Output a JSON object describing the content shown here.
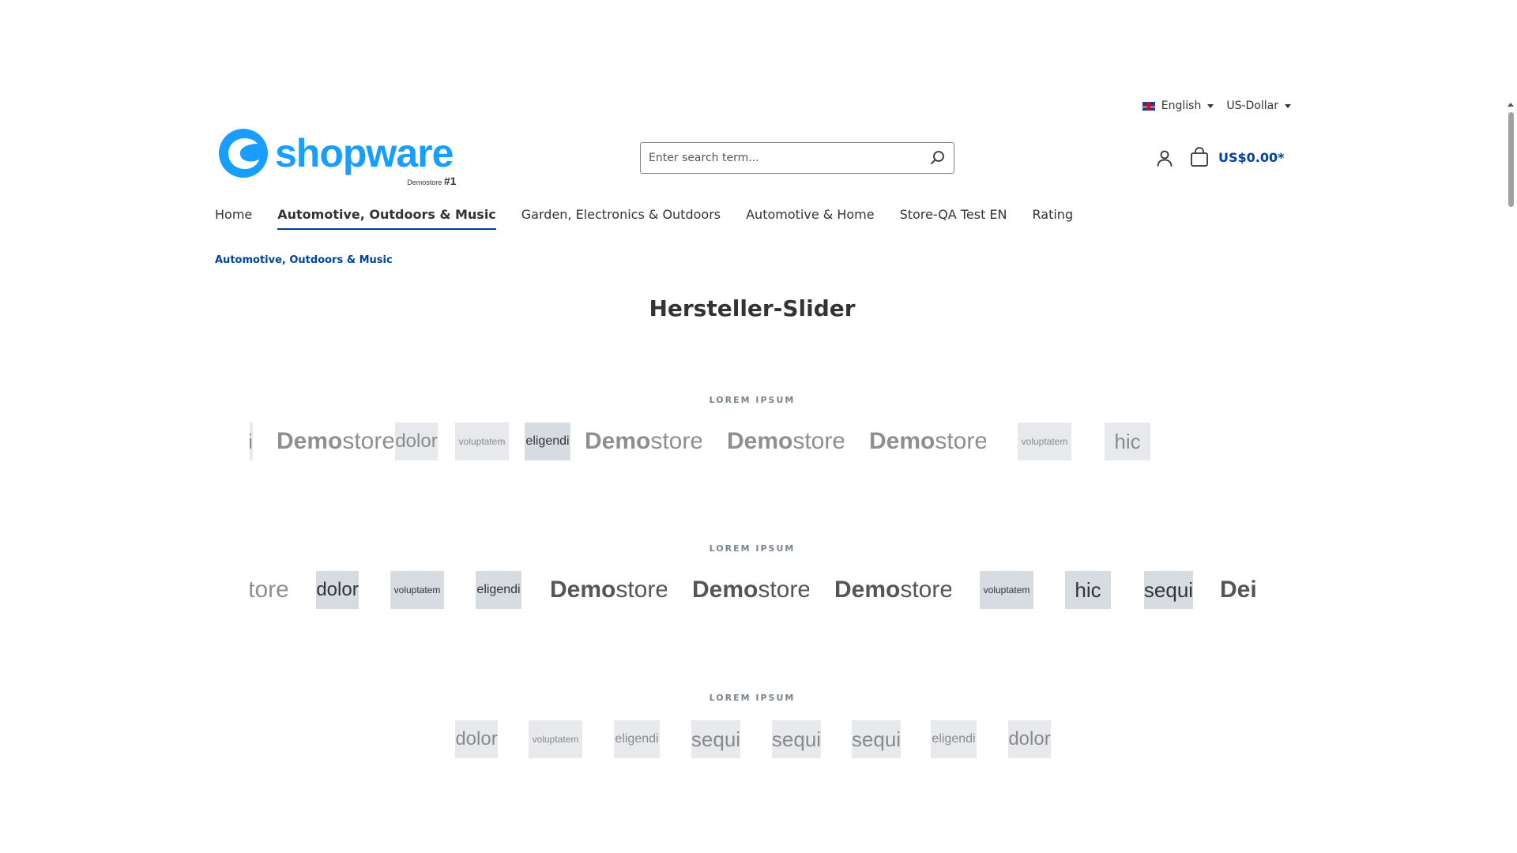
{
  "topbar": {
    "language": "English",
    "currency": "US-Dollar"
  },
  "header": {
    "logo_text": "shopware",
    "logo_sub": "Demostore",
    "logo_badge": "#1",
    "search_placeholder": "Enter search term...",
    "cart_total": "US$0.00*"
  },
  "nav": {
    "items": [
      {
        "label": "Home"
      },
      {
        "label": "Automotive, Outdoors & Music"
      },
      {
        "label": "Garden, Electronics & Outdoors"
      },
      {
        "label": "Automotive & Home"
      },
      {
        "label": "Store-QA Test EN"
      },
      {
        "label": "Rating"
      }
    ],
    "active_index": 1
  },
  "breadcrumb": "Automotive, Outdoors & Music",
  "page_title": "Hersteller-Slider",
  "sliders": [
    {
      "title": "LOREM IPSUM",
      "items": [
        {
          "text": "i",
          "kind": "word"
        },
        {
          "bold": "Demo",
          "rest": "store",
          "kind": "demostore"
        },
        {
          "text": "dolor",
          "kind": "word"
        },
        {
          "text": "voluptatem",
          "kind": "word"
        },
        {
          "text": "eligendi",
          "kind": "word"
        },
        {
          "bold": "Demo",
          "rest": "store",
          "kind": "demostore"
        },
        {
          "bold": "Demo",
          "rest": "store",
          "kind": "demostore"
        },
        {
          "bold": "Demo",
          "rest": "store",
          "kind": "demostore"
        },
        {
          "text": "voluptatem",
          "kind": "word"
        },
        {
          "text": "hic",
          "kind": "word"
        }
      ]
    },
    {
      "title": "LOREM IPSUM",
      "items": [
        {
          "text": "tore",
          "kind": "word"
        },
        {
          "text": "dolor",
          "kind": "word"
        },
        {
          "text": "voluptatem",
          "kind": "word"
        },
        {
          "text": "eligendi",
          "kind": "word"
        },
        {
          "bold": "Demo",
          "rest": "store",
          "kind": "demostore"
        },
        {
          "bold": "Demo",
          "rest": "store",
          "kind": "demostore"
        },
        {
          "bold": "Demo",
          "rest": "store",
          "kind": "demostore"
        },
        {
          "text": "voluptatem",
          "kind": "word"
        },
        {
          "text": "hic",
          "kind": "word"
        },
        {
          "text": "sequi",
          "kind": "word"
        },
        {
          "text": "Dei",
          "kind": "word"
        }
      ]
    },
    {
      "title": "LOREM IPSUM",
      "items": [
        {
          "text": "dolor",
          "kind": "word"
        },
        {
          "text": "voluptatem",
          "kind": "word"
        },
        {
          "text": "eligendi",
          "kind": "word"
        },
        {
          "text": "sequi",
          "kind": "word"
        },
        {
          "text": "sequi",
          "kind": "word"
        },
        {
          "text": "sequi",
          "kind": "word"
        },
        {
          "text": "eligendi",
          "kind": "word"
        },
        {
          "text": "dolor",
          "kind": "word"
        }
      ]
    }
  ]
}
